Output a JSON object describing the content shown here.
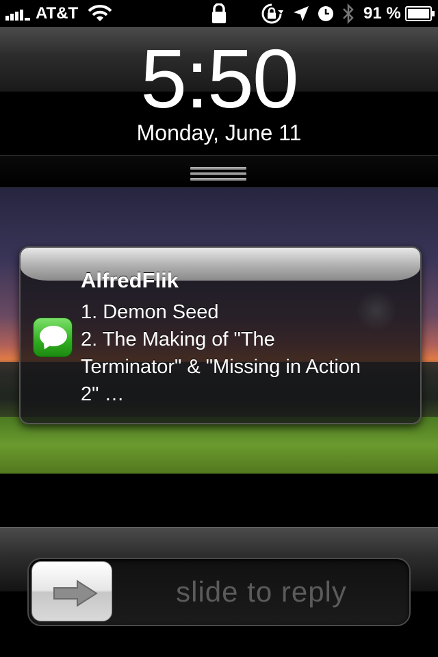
{
  "status_bar": {
    "carrier": "AT&T",
    "battery_percent": "91 %",
    "signal_bars": 4,
    "icons": [
      "signal-bars-icon",
      "wifi-icon",
      "lock-icon",
      "rotation-lock-icon",
      "location-arrow-icon",
      "alarm-clock-icon",
      "bluetooth-icon",
      "battery-icon"
    ]
  },
  "clock": {
    "time": "5:50",
    "date": "Monday, June 11"
  },
  "notification": {
    "app_icon": "messages-icon",
    "sender": "AlfredFlik",
    "lines": [
      "1. Demon Seed",
      "2. The Making of \"The",
      "Terminator\" & \"Missing in Action",
      "2\" …"
    ]
  },
  "slider": {
    "label": "slide to reply",
    "knob_icon": "arrow-right-icon"
  },
  "colors": {
    "messages_green": "#2fae1f",
    "slider_text": "#5b5b5b"
  }
}
